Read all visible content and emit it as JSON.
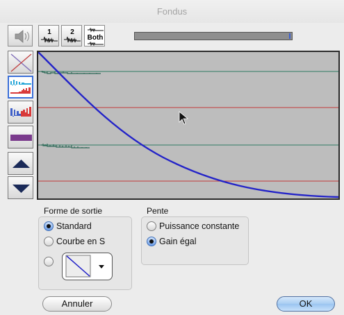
{
  "window": {
    "title": "Fondus"
  },
  "toolbar": {
    "speaker_icon": "speaker-icon",
    "track1_label": "1",
    "track2_label": "2",
    "both_label": "Both",
    "progress_fraction": 0.99
  },
  "side_tools": [
    {
      "name": "no-fade-tool",
      "icon": "x-icon",
      "selected": false
    },
    {
      "name": "fade-waveform-tool",
      "icon": "fade-waveform-icon",
      "selected": true
    },
    {
      "name": "reverse-fade-tool",
      "icon": "reverse-fade-icon",
      "selected": false
    },
    {
      "name": "flat-tool",
      "icon": "flat-bar-icon",
      "selected": false
    },
    {
      "name": "zoom-up-button",
      "icon": "triangle-up-icon",
      "selected": false
    },
    {
      "name": "zoom-down-button",
      "icon": "triangle-down-icon",
      "selected": false
    }
  ],
  "forme": {
    "label": "Forme de sortie",
    "options": [
      "Standard",
      "Courbe en S"
    ],
    "selected": "Standard",
    "curve_icon": "linear-curve-icon"
  },
  "pente": {
    "label": "Pente",
    "options": [
      "Puissance constante",
      "Gain égal"
    ],
    "selected": "Gain égal"
  },
  "buttons": {
    "cancel": "Annuler",
    "ok": "OK"
  },
  "colors": {
    "fade_curve": "#2a2ad0",
    "track_line": "#2f7a64",
    "boundary_line": "#c23a3a",
    "default_button": "#9ac4f0"
  }
}
